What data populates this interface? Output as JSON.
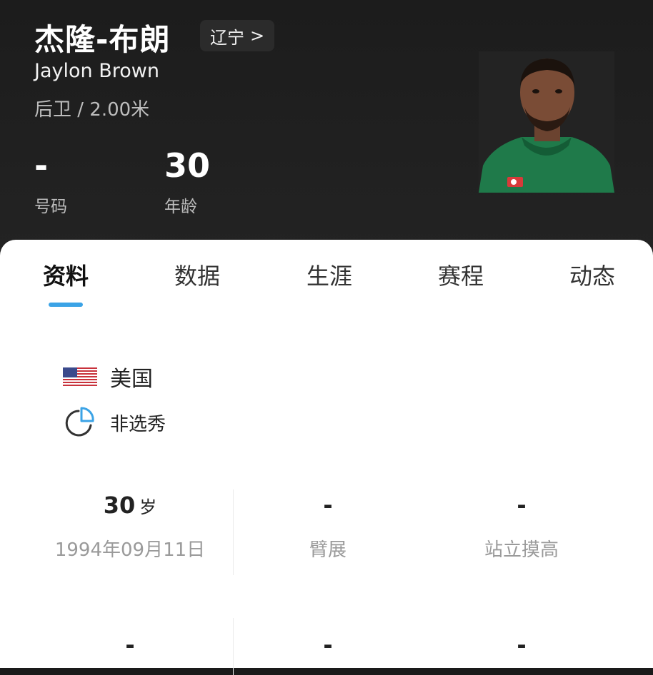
{
  "player": {
    "name_cn": "杰隆-布朗",
    "name_en": "Jaylon Brown",
    "team": "辽宁",
    "team_arrow": ">",
    "position_height": "后卫 / 2.00米",
    "stats": [
      {
        "value": "-",
        "label": "号码"
      },
      {
        "value": "30",
        "label": "年龄"
      }
    ]
  },
  "tabs": [
    "资料",
    "数据",
    "生涯",
    "赛程",
    "动态"
  ],
  "active_tab": "资料",
  "profile": {
    "nationality": "美国",
    "nationality_icon": "us-flag-icon",
    "draft": "非选秀",
    "draft_icon": "draft-pie-icon"
  },
  "details": {
    "age_value": "30",
    "age_unit": "岁",
    "birthday": "1994年09月11日",
    "wingspan_value": "-",
    "wingspan_label": "臂展",
    "reach_value": "-",
    "reach_label": "站立摸高",
    "row2": [
      "-",
      "-",
      "-"
    ]
  },
  "colors": {
    "header_bg": "#1c1c1c",
    "accent": "#3ba3e6",
    "jersey": "#1f7a4a"
  }
}
